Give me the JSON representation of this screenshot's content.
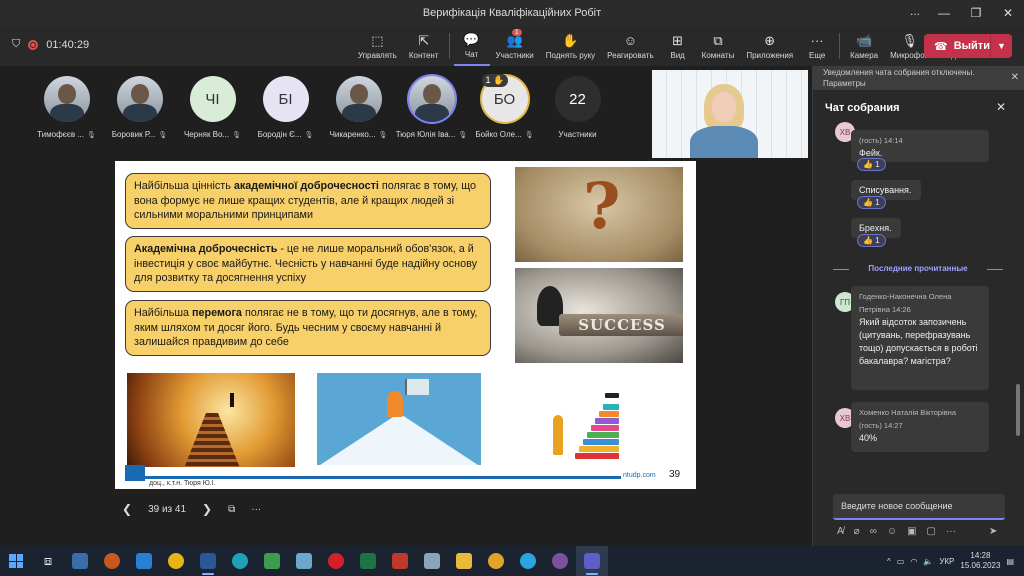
{
  "window": {
    "title": "Верифікація Кваліфікаційних Робіт",
    "more": "..."
  },
  "status": {
    "timer": "01:40:29"
  },
  "toolbar": {
    "items": [
      {
        "label": "Управлять",
        "icon": "share-tray-icon"
      },
      {
        "label": "Контент",
        "icon": "share-icon"
      },
      {
        "label": "Чат",
        "icon": "chat-icon"
      },
      {
        "label": "Участники",
        "icon": "people-icon",
        "badge": "1"
      },
      {
        "label": "Поднять руку",
        "icon": "hand-icon"
      },
      {
        "label": "Реагировать",
        "icon": "smile-icon"
      },
      {
        "label": "Вид",
        "icon": "grid-icon"
      },
      {
        "label": "Комнаты",
        "icon": "rooms-icon"
      },
      {
        "label": "Приложения",
        "icon": "plus-icon"
      },
      {
        "label": "Еще",
        "icon": "more-icon"
      },
      {
        "label": "Камера",
        "icon": "camera-icon"
      },
      {
        "label": "Микрофон",
        "icon": "mic-off-icon"
      },
      {
        "label": "Поделиться",
        "icon": "upload-icon"
      }
    ],
    "leave_label": "Выйти"
  },
  "participants": [
    {
      "name": "Тимофєєв ...",
      "initials": "",
      "photo": true
    },
    {
      "name": "Боровик Р...",
      "initials": "",
      "photo": true
    },
    {
      "name": "Черняк Во...",
      "initials": "ЧІ",
      "color": "#d8ecd8"
    },
    {
      "name": "Бородін Є...",
      "initials": "БІ",
      "color": "#e6e3f3"
    },
    {
      "name": "Чикаренко...",
      "initials": "",
      "photo": true
    },
    {
      "name": "Тюря Юлія Іва...",
      "initials": "",
      "photo": true
    },
    {
      "name": "Бойко Оле...",
      "initials": "БО",
      "color": "#e7e7e7",
      "hand": "1 ✋"
    },
    {
      "name": "Участники",
      "initials": "22",
      "color": "#2e2e2e"
    }
  ],
  "slide": {
    "boxes": [
      {
        "pre": "Найбільша цінність ",
        "bold": "академічної доброчесності",
        "post": " полягає в тому, що вона формує не лише кращих студентів, але й кращих людей зі сильними моральними принципами"
      },
      {
        "pre": "",
        "bold": "Академічна доброчесність",
        "post": " - це не лише моральний обов'язок, а й інвестиція у своє майбутнє. Чесність у навчанні буде надійну основу для розвитку та досягнення успіху"
      },
      {
        "pre": "Найбільша ",
        "bold": "перемога",
        "post": " полягає не в тому, що ти досягнув, але в тому, яким шляхом ти досяг його. Будь чесним у своєму навчанні й залишайся правдивим до себе"
      }
    ],
    "key_word": "SUCCESS",
    "question_mark": "?",
    "author": "доц., к.т.н. Тюря Ю.І.",
    "site": "ntudp.com",
    "number": "39"
  },
  "slide_nav": {
    "counter": "39 из 41"
  },
  "chat": {
    "notice_line1": "Уведомления чата собрания отключены.",
    "notice_line2": "Параметры",
    "title": "Чат собрания",
    "top_initials": "ХВ",
    "top_meta": "(гость)   14:14",
    "m1": "Фейк.",
    "m2": "Списування.",
    "m3": "Брехня.",
    "reaction": "👍 1",
    "last_read": "Последние прочитанные",
    "gp_initials": "ГП",
    "gp_name": "Годенко-Наконечна Олена",
    "gp_meta": "Петрівна        14:26",
    "gp_text": "Який відсоток запозичень (цитувань, перефразувань тощо) допускається в роботі бакалавра? магістра?",
    "hv_initials": "ХВ",
    "hv_name": "Хоменко Наталія Вікторівна",
    "hv_meta": "(гость)          14:27",
    "hv_text": "40%",
    "compose_placeholder": "Введите новое сообщение"
  },
  "taskbar": {
    "lang": "УКР",
    "time": "14:28",
    "date": "15.06.2023"
  }
}
